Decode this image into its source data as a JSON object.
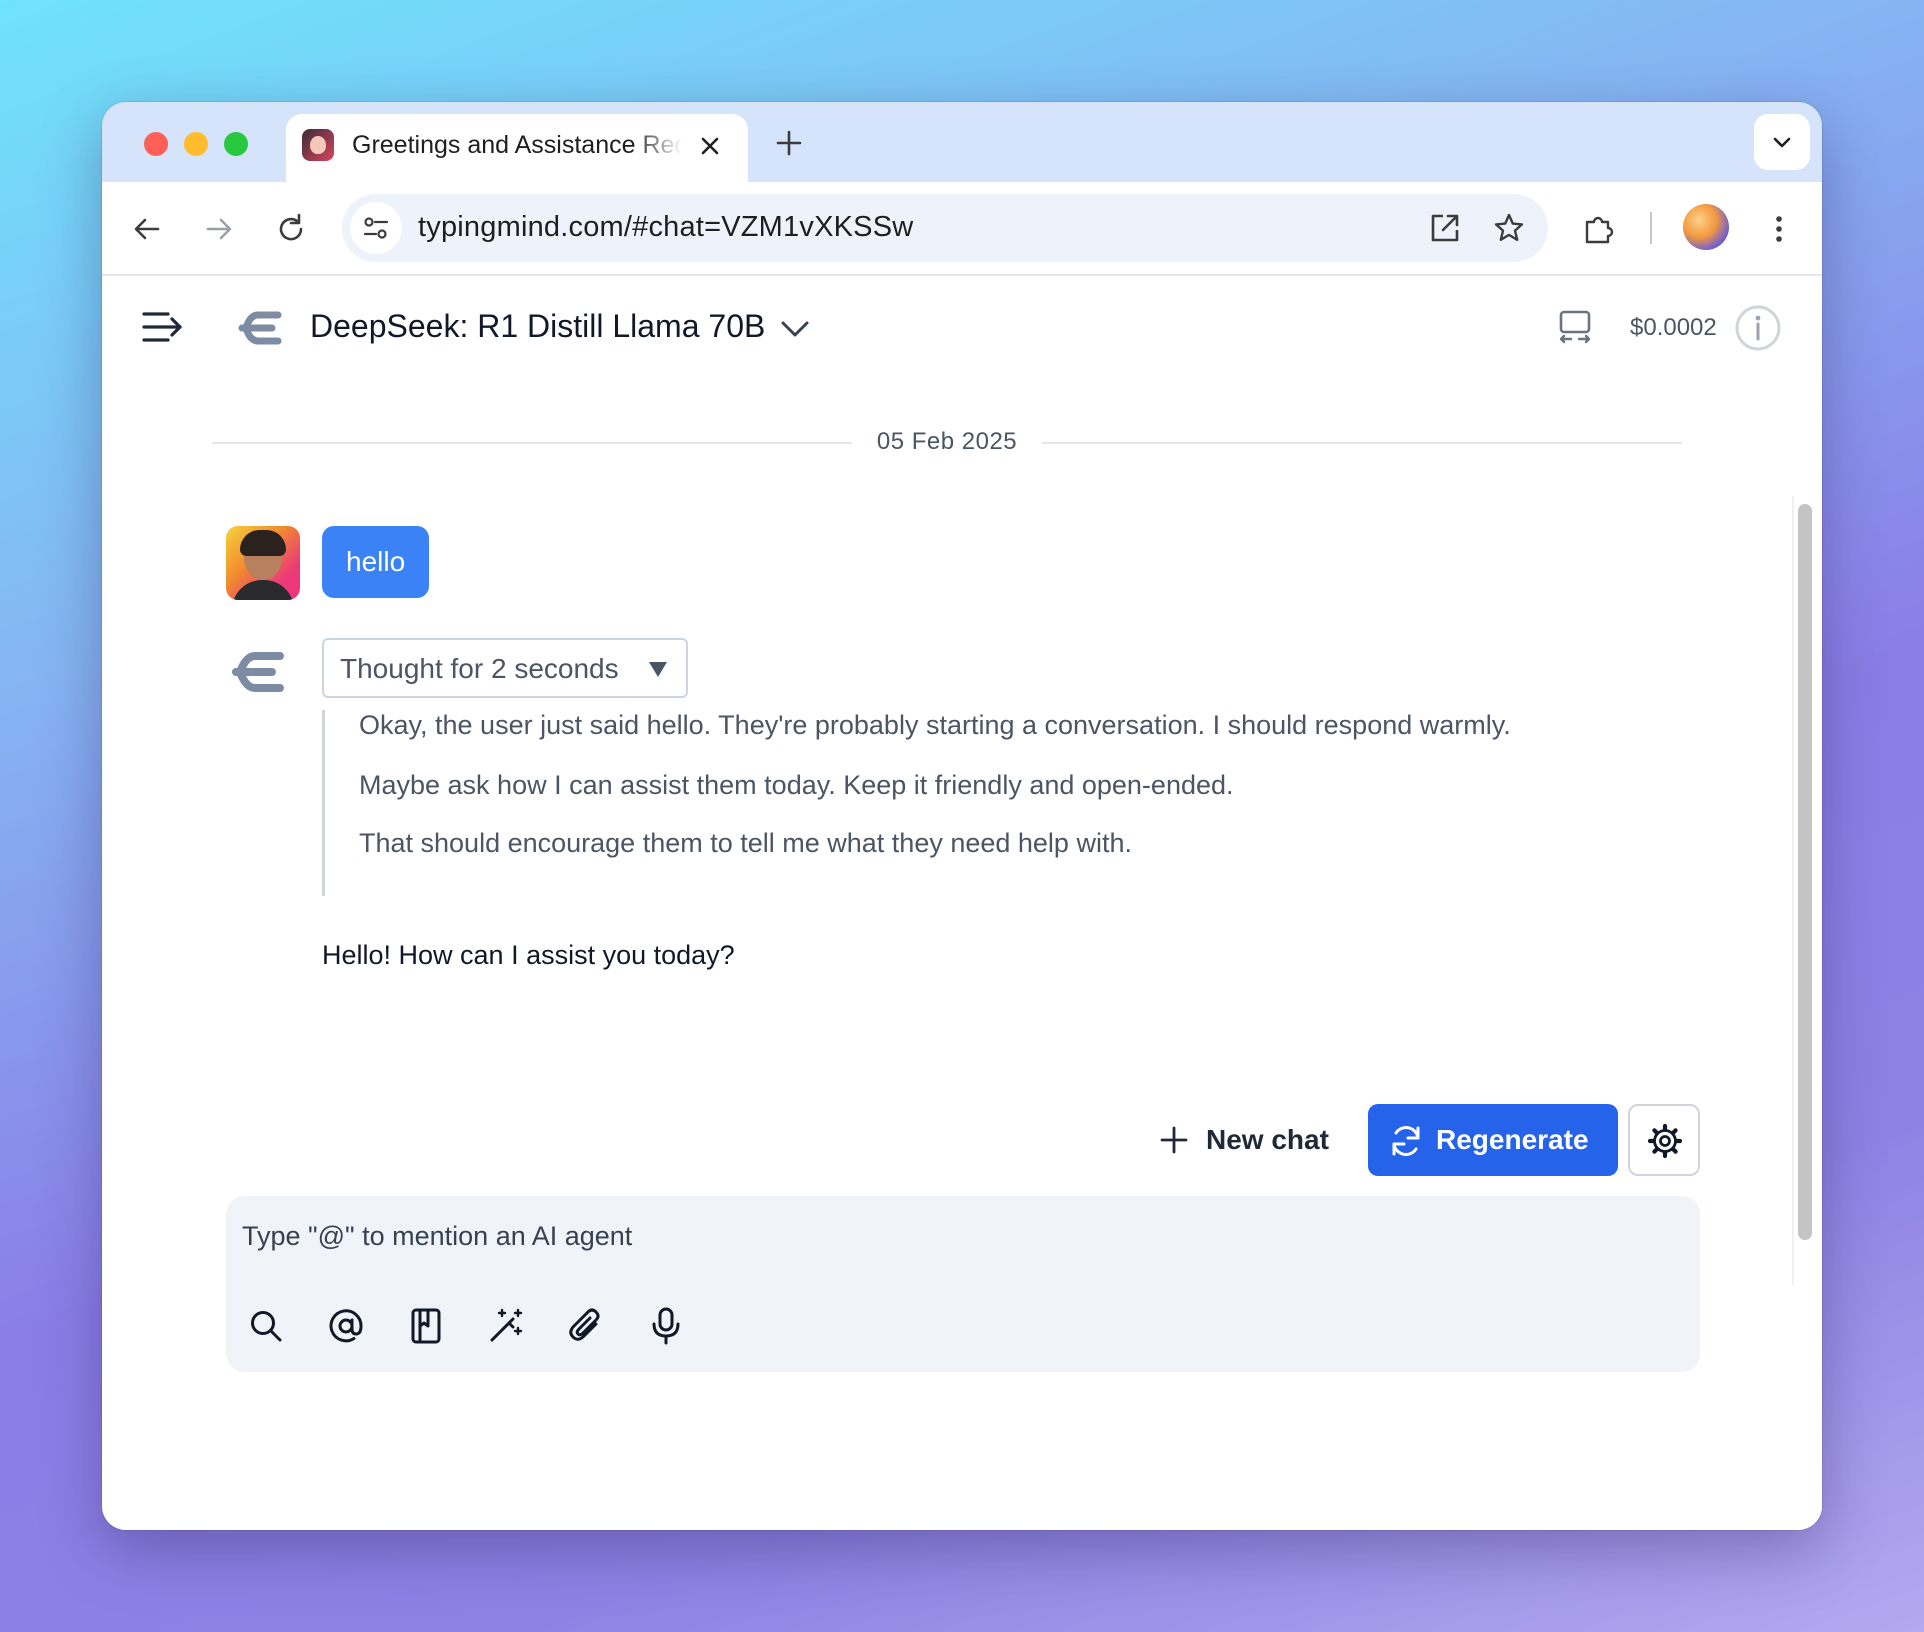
{
  "browser": {
    "tab": {
      "title": "Greetings and Assistance Request"
    },
    "url": "typingmind.com/#chat=VZM1vXKSSw"
  },
  "header": {
    "model_name": "DeepSeek: R1 Distill Llama 70B",
    "cost": "$0.0002"
  },
  "chat": {
    "date": "05 Feb 2025",
    "user_message": "hello",
    "thought_toggle": "Thought for 2 seconds",
    "thought_caret": "▼",
    "thoughts": [
      "Okay, the user just said hello. They're probably starting a conversation. I should respond warmly.",
      "Maybe ask how I can assist them today. Keep it friendly and open-ended.",
      "That should encourage them to tell me what they need help with."
    ],
    "reply": "Hello! How can I assist you today?"
  },
  "actions": {
    "new_chat": "New chat",
    "regenerate": "Regenerate"
  },
  "composer": {
    "placeholder": "Type \"@\" to mention an AI agent",
    "value": ""
  },
  "colors": {
    "accent": "#2563eb",
    "user_bubble": "#3b82f6",
    "composer_bg": "#f0f4f9"
  }
}
